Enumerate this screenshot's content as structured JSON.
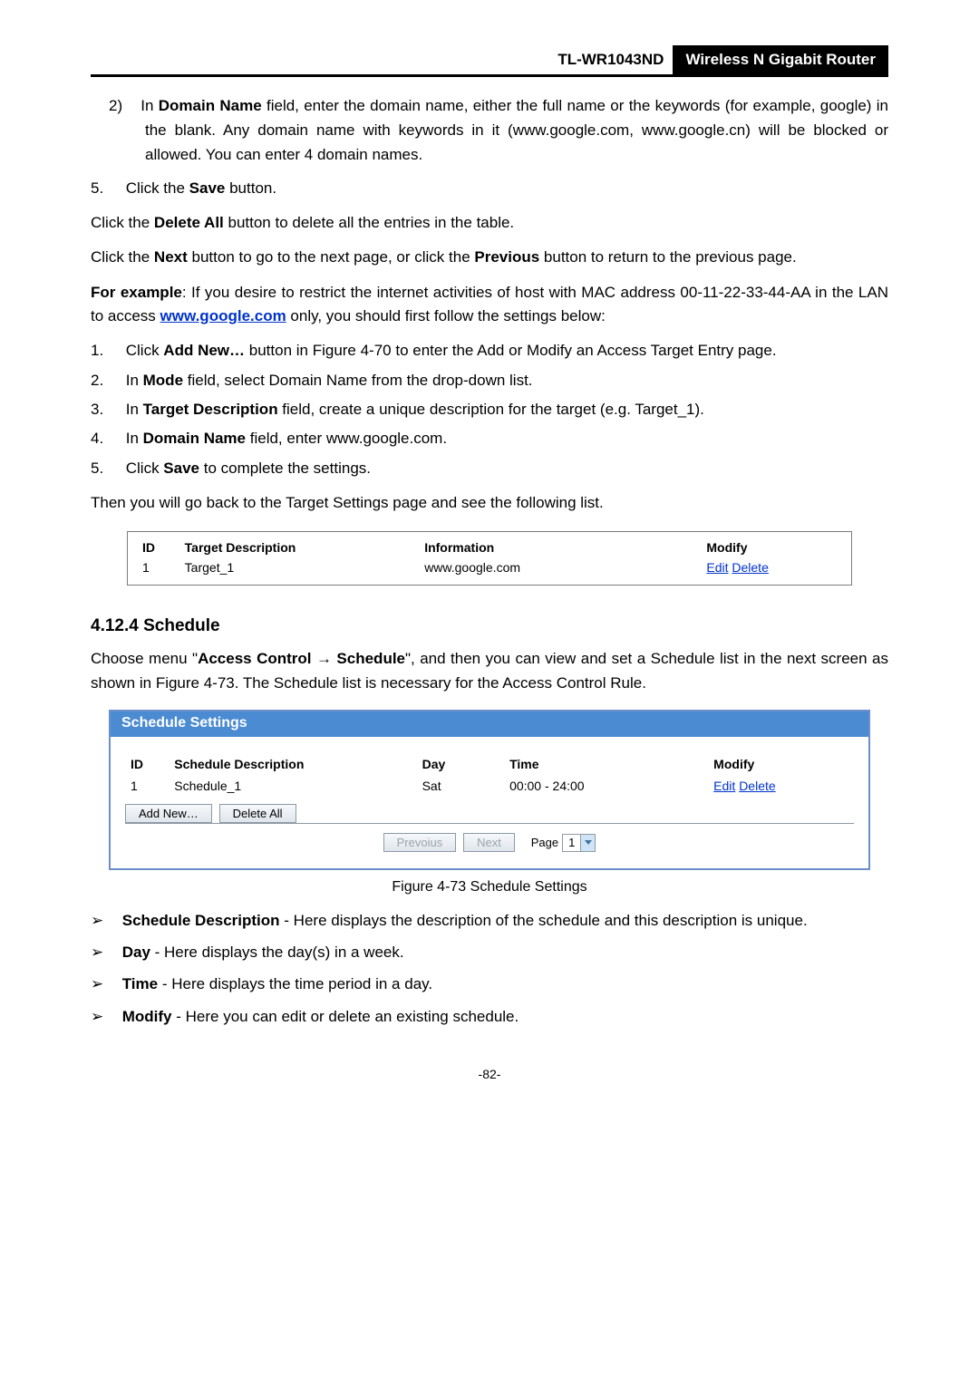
{
  "header": {
    "model": "TL-WR1043ND",
    "product": "Wireless N Gigabit Router"
  },
  "intro_sublist": {
    "num": "2)",
    "text_before_bold": "In ",
    "bold": "Domain Name",
    "text_after": " field, enter the domain name, either the full name or the keywords (for example, google) in the blank. Any domain name with keywords in it (www.google.com, www.google.cn) will be blocked or allowed. You can enter 4 domain names."
  },
  "step5": {
    "num": "5.",
    "before": "Click the ",
    "bold": "Save",
    "after": " button."
  },
  "p_delete": {
    "before": "Click the ",
    "bold": "Delete All",
    "after": " button to delete all the entries in the table."
  },
  "p_next": {
    "before": "Click the ",
    "bold1": "Next",
    "mid": " button to go to the next page, or click the ",
    "bold2": "Previous",
    "after": " button to return to the previous page."
  },
  "example": {
    "bold_lead": "For example",
    "text1": ": If you desire to restrict the internet activities of host with MAC address 00-11-22-33-44-AA in the LAN to access ",
    "link": "www.google.com",
    "text2": " only, you should first follow the settings below:"
  },
  "steps": [
    {
      "num": "1.",
      "pre": "Click ",
      "b": "Add New…",
      "post": " button in Figure 4-70 to enter the Add or Modify an Access Target Entry page."
    },
    {
      "num": "2.",
      "pre": "In ",
      "b": "Mode",
      "post": " field, select Domain Name from the drop-down list."
    },
    {
      "num": "3.",
      "pre": "In ",
      "b": "Target Description",
      "post": " field, create a unique description for the target (e.g. Target_1)."
    },
    {
      "num": "4.",
      "pre": "In ",
      "b": "Domain Name",
      "post": " field, enter www.google.com."
    },
    {
      "num": "5.",
      "pre": "Click ",
      "b": "Save",
      "post": " to complete the settings."
    }
  ],
  "then_line": "Then you will go back to the Target Settings page and see the following list.",
  "table1": {
    "headers": {
      "id": "ID",
      "desc": "Target Description",
      "info": "Information",
      "mod": "Modify"
    },
    "row": {
      "id": "1",
      "desc": "Target_1",
      "info": "www.google.com",
      "edit": "Edit",
      "del": "Delete"
    }
  },
  "section": "4.12.4  Schedule",
  "sched_intro": {
    "t1": "Choose menu \"",
    "b1": "Access Control",
    "arrow": " → ",
    "b2": "Schedule",
    "t2": "\", and then you can view and set a Schedule list in the next screen as shown in Figure 4-73. The Schedule list is necessary for the Access Control Rule."
  },
  "sched_panel": {
    "title": "Schedule Settings",
    "headers": {
      "id": "ID",
      "desc": "Schedule Description",
      "day": "Day",
      "time": "Time",
      "mod": "Modify"
    },
    "row": {
      "id": "1",
      "desc": "Schedule_1",
      "day": "Sat",
      "time": "00:00 - 24:00",
      "edit": "Edit",
      "del": "Delete"
    },
    "btn_add": "Add New…",
    "btn_delall": "Delete All",
    "btn_prev": "Prevoius",
    "btn_next": "Next",
    "page_label": "Page",
    "page_val": "1"
  },
  "figure_caption": "Figure 4-73   Schedule Settings",
  "bullets": [
    {
      "b": "Schedule Description",
      "t": " - Here displays the description of the schedule and this description is unique."
    },
    {
      "b": "Day",
      "t": " - Here displays the day(s) in a week."
    },
    {
      "b": "Time",
      "t": " - Here displays the time period in a day."
    },
    {
      "b": "Modify",
      "t": " - Here you can edit or delete an existing schedule."
    }
  ],
  "page_number": "-82-"
}
